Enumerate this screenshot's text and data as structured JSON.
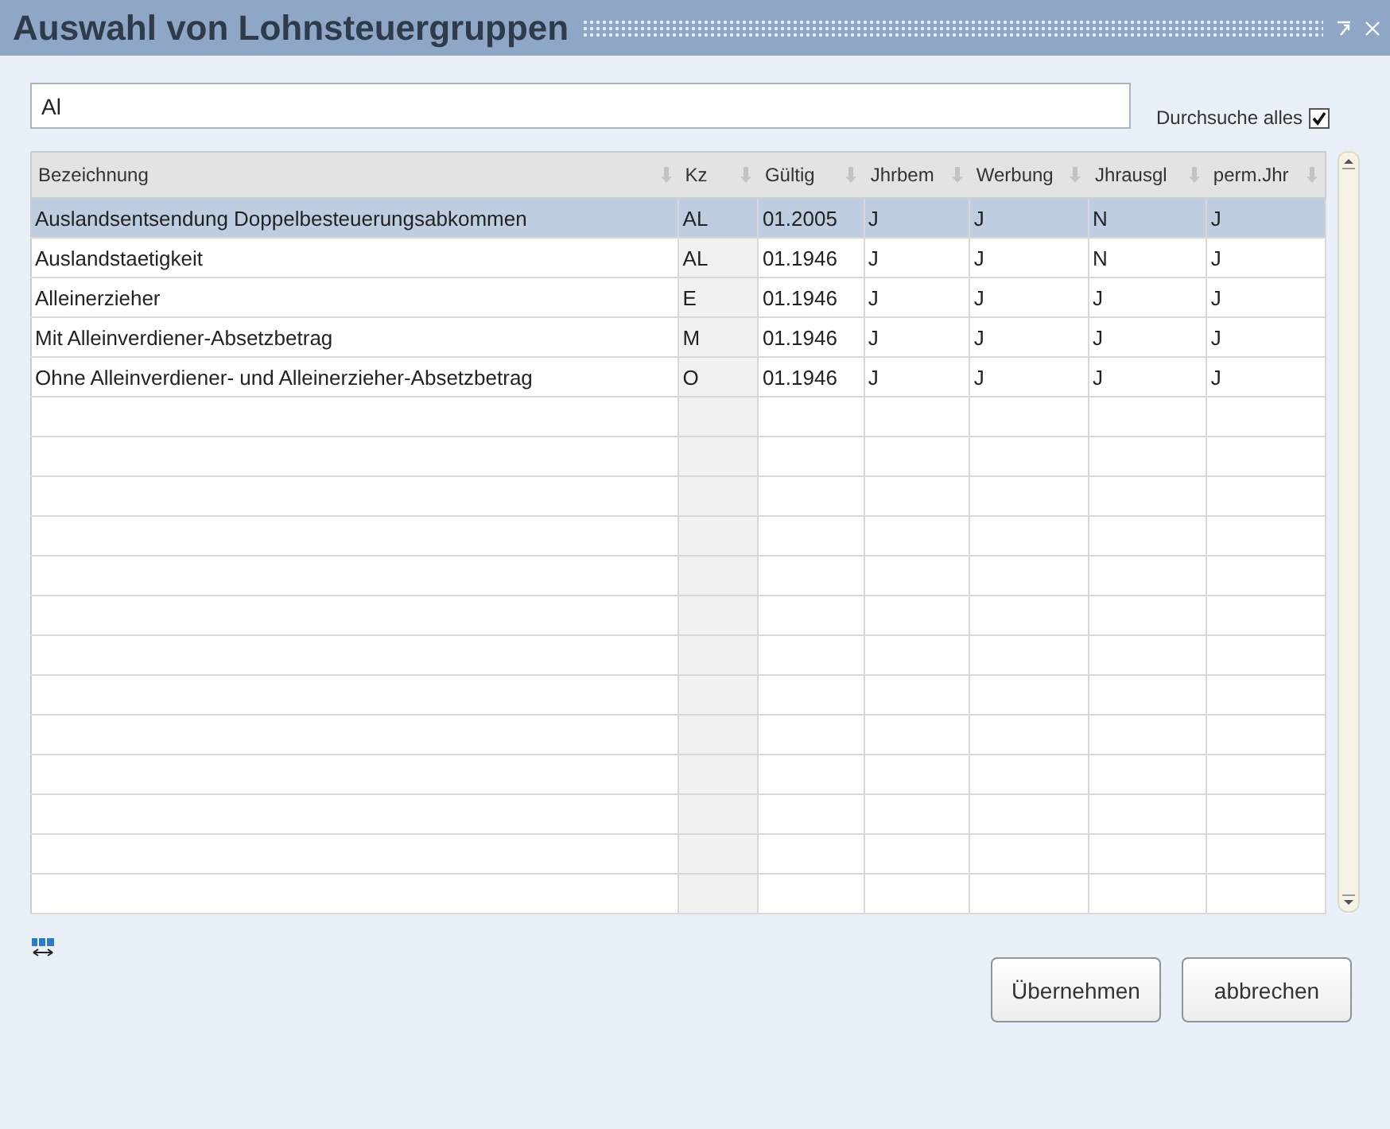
{
  "window": {
    "title": "Auswahl von Lohnsteuergruppen"
  },
  "search": {
    "value": "Al"
  },
  "search_all": {
    "label": "Durchsuche alles",
    "checked": true
  },
  "table": {
    "columns": [
      "Bezeichnung",
      "Kz",
      "Gültig",
      "Jhrbem",
      "Werbung",
      "Jhrausgl",
      "perm.Jhr"
    ],
    "rows": [
      {
        "selected": true,
        "cells": [
          "Auslandsentsendung Doppelbesteuerungsabkommen",
          "AL",
          "01.2005",
          "J",
          "J",
          "N",
          "J"
        ]
      },
      {
        "selected": false,
        "cells": [
          "Auslandstaetigkeit",
          "AL",
          "01.1946",
          "J",
          "J",
          "N",
          "J"
        ]
      },
      {
        "selected": false,
        "cells": [
          "Alleinerzieher",
          "E",
          "01.1946",
          "J",
          "J",
          "J",
          "J"
        ]
      },
      {
        "selected": false,
        "cells": [
          "Mit Alleinverdiener-Absetzbetrag",
          "M",
          "01.1946",
          "J",
          "J",
          "J",
          "J"
        ]
      },
      {
        "selected": false,
        "cells": [
          "Ohne Alleinverdiener- und Alleinerzieher-Absetzbetrag",
          "O",
          "01.1946",
          "J",
          "J",
          "J",
          "J"
        ]
      }
    ]
  },
  "buttons": [
    "Übernehmen",
    "abbrechen"
  ]
}
